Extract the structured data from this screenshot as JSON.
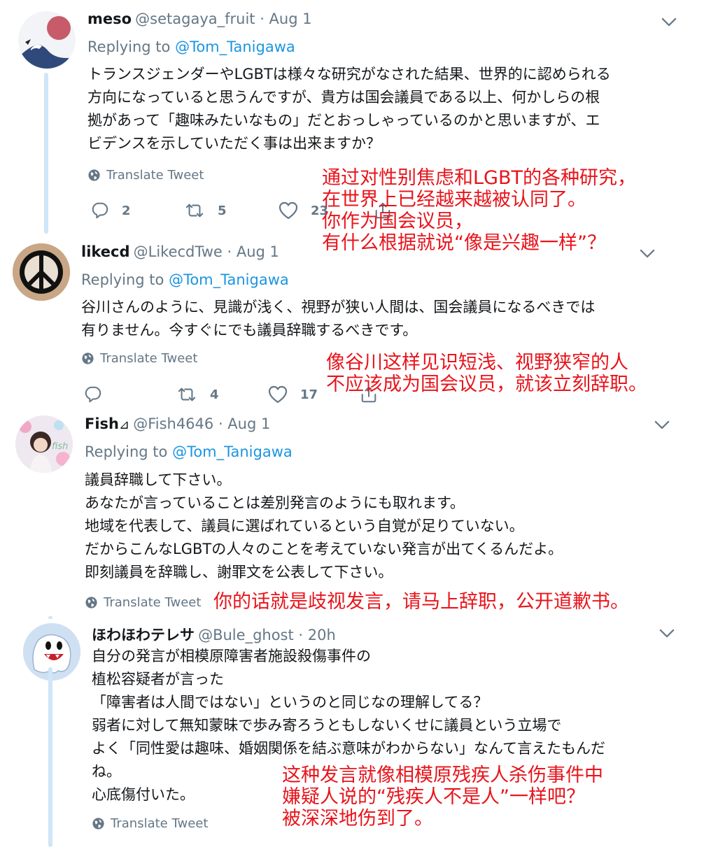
{
  "tweets": [
    {
      "name": "meso",
      "handle": "@setagaya_fruit · Aug 1",
      "replying_prefix": "Replying to ",
      "replying_to": "@Tom_Tanigawa",
      "lines": [
        "トランスジェンダーやLGBTは様々な研究がなされた結果、世界的に認められる",
        "方向になっていると思うんですが、貴方は国会議員である以上、何かしらの根",
        "拠があって「趣味みたいなもの」だとおっしゃっているのかと思いますが、エ",
        "ビデンスを示していただく事は出来ますか？"
      ],
      "translate": "Translate Tweet",
      "replies": "2",
      "retweets": "5",
      "likes": "23",
      "annotation": [
        "通过对性别焦虑和LGBT的各种研究，",
        "在世界上已经越来越被认同了。",
        "你作为国会议员，",
        "有什么根据就说“像是兴趣一样”？"
      ]
    },
    {
      "name": "likecd",
      "handle": "@LikecdTwe · Aug 1",
      "replying_prefix": "Replying to ",
      "replying_to": "@Tom_Tanigawa",
      "lines": [
        "谷川さんのように、見識が浅く、視野が狭い人間は、国会議員になるべきでは",
        "有りません。今すぐにでも議員辞職するべきです。"
      ],
      "translate": "Translate Tweet",
      "replies": "",
      "retweets": "4",
      "likes": "17",
      "annotation": [
        "像谷川这样见识短浅、视野狭窄的人",
        "不应该成为国会议员，就该立刻辞职。"
      ]
    },
    {
      "name": "Fish",
      "name_suffix": "⊿",
      "handle": "@Fish4646 · Aug 1",
      "replying_prefix": "Replying to ",
      "replying_to": "@Tom_Tanigawa",
      "avatar_text": "fish",
      "lines": [
        "議員辞職して下さい。",
        "あなたが言っていることは差別発言のようにも取れます。",
        "地域を代表して、議員に選ばれているという自覚が足りていない。",
        "だからこんなLGBTの人々のことを考えていない発言が出てくるんだよ。",
        "即刻議員を辞職し、謝罪文を公表して下さい。"
      ],
      "translate": "Translate Tweet",
      "annotation": [
        "你的话就是歧视发言，请马上辞职，公开道歉书。"
      ]
    },
    {
      "name": "ほわほわテレサ",
      "handle": "@Bule_ghost · 20h",
      "lines": [
        "自分の発言が相模原障害者施設殺傷事件の",
        "植松容疑者が言った",
        "「障害者は人間ではない」というのと同じなの理解してる？",
        "弱者に対して無知蒙昧で歩み寄ろうともしないくせに議員という立場で",
        "よく「同性愛は趣味、婚姻関係を結ぶ意味がわからない」なんて言えたもんだ",
        "ね。",
        "心底傷付いた。"
      ],
      "translate": "Translate Tweet",
      "annotation": [
        "这种发言就像相模原残疾人杀伤事件中",
        "嫌疑人说的“残疾人不是人”一样吧？",
        "被深深地伤到了。"
      ]
    }
  ],
  "colors": {
    "link": "#1b95e0",
    "muted": "#657786",
    "text": "#14171a",
    "annotation": "#e8141b",
    "thread_line": "#cfe6f7"
  },
  "icons": [
    "globe-icon",
    "reply-icon",
    "retweet-icon",
    "like-icon",
    "share-icon",
    "chevron-down-icon"
  ]
}
